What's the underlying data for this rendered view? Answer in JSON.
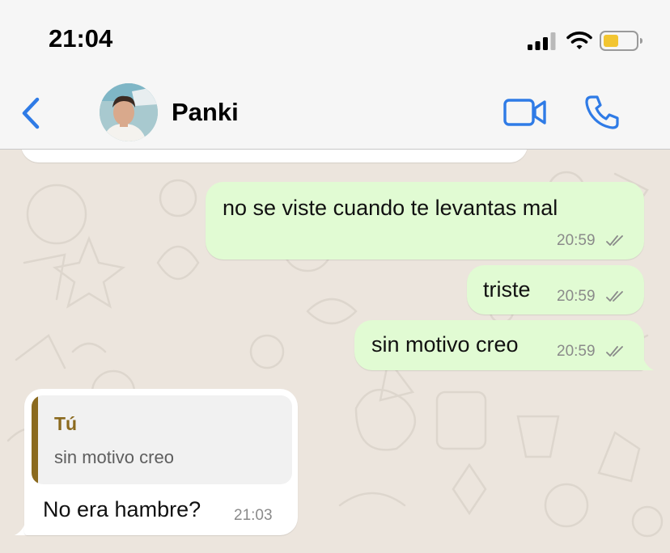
{
  "status_bar": {
    "time": "21:04"
  },
  "header": {
    "contact_name": "Panki"
  },
  "messages": [
    {
      "direction": "out",
      "text": "no se viste cuando te levantas mal",
      "time": "20:59"
    },
    {
      "direction": "out",
      "text": "triste",
      "time": "20:59"
    },
    {
      "direction": "out",
      "text": "sin motivo creo",
      "time": "20:59"
    },
    {
      "direction": "in",
      "reply_to": {
        "author": "Tú",
        "text": "sin motivo creo"
      },
      "text": "No era hambre?",
      "time": "21:03"
    }
  ],
  "colors": {
    "accent": "#2f7be6",
    "outgoing_bubble": "#e1fbd3",
    "incoming_bubble": "#ffffff",
    "chat_background": "#ece5dd",
    "quote_author": "#8b6a1e",
    "battery_level": "#f2c531"
  }
}
